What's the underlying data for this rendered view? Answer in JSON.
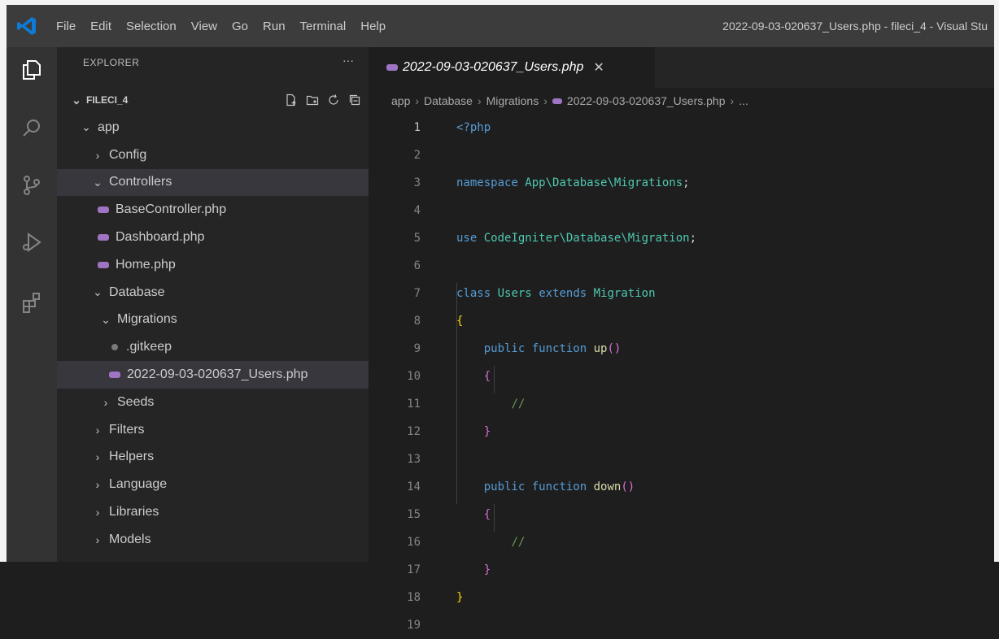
{
  "titlebar": {
    "menu": [
      "File",
      "Edit",
      "Selection",
      "View",
      "Go",
      "Run",
      "Terminal",
      "Help"
    ],
    "window_title": "2022-09-03-020637_Users.php - fileci_4 - Visual Stu"
  },
  "activity_bar": {
    "icons": [
      "explorer-icon",
      "search-icon",
      "source-control-icon",
      "run-debug-icon",
      "extensions-icon"
    ]
  },
  "sidebar": {
    "title": "EXPLORER",
    "more": "···",
    "project": "FILECI_4",
    "tree": [
      {
        "label": "app",
        "chevron": "⌄"
      },
      {
        "label": "Config",
        "chevron": "›"
      },
      {
        "label": "Controllers",
        "chevron": "⌄"
      },
      {
        "label": "BaseController.php"
      },
      {
        "label": "Dashboard.php"
      },
      {
        "label": "Home.php"
      },
      {
        "label": "Database",
        "chevron": "⌄"
      },
      {
        "label": "Migrations",
        "chevron": "⌄"
      },
      {
        "label": ".gitkeep"
      },
      {
        "label": "2022-09-03-020637_Users.php"
      },
      {
        "label": "Seeds",
        "chevron": "›"
      },
      {
        "label": "Filters",
        "chevron": "›"
      },
      {
        "label": "Helpers",
        "chevron": "›"
      },
      {
        "label": "Language",
        "chevron": "›"
      },
      {
        "label": "Libraries",
        "chevron": "›"
      },
      {
        "label": "Models",
        "chevron": "›"
      }
    ]
  },
  "editor": {
    "tab": {
      "label": "2022-09-03-020637_Users.php",
      "close": "✕"
    },
    "breadcrumb": [
      "app",
      "Database",
      "Migrations",
      "2022-09-03-020637_Users.php",
      "..."
    ],
    "line_numbers": [
      "1",
      "2",
      "3",
      "4",
      "5",
      "6",
      "7",
      "8",
      "9",
      "10",
      "11",
      "12",
      "13",
      "14",
      "15",
      "16",
      "17",
      "18",
      "19"
    ],
    "code": {
      "l1": "<?php",
      "l3_kw": "namespace",
      "l3_ns": "App\\Database\\Migrations",
      "l3_end": ";",
      "l5_kw": "use",
      "l5_ns": "CodeIgniter\\Database\\Migration",
      "l5_end": ";",
      "l7_kw": "class",
      "l7_name": "Users",
      "l7_ext": "extends",
      "l7_parent": "Migration",
      "l8": "{",
      "l9_kw1": "public",
      "l9_kw2": "function",
      "l9_fn": "up",
      "l9_paren": "()",
      "l10": "{",
      "l11": "//",
      "l12": "}",
      "l14_kw1": "public",
      "l14_kw2": "function",
      "l14_fn": "down",
      "l14_paren": "()",
      "l15": "{",
      "l16": "//",
      "l17": "}",
      "l18": "}"
    }
  }
}
